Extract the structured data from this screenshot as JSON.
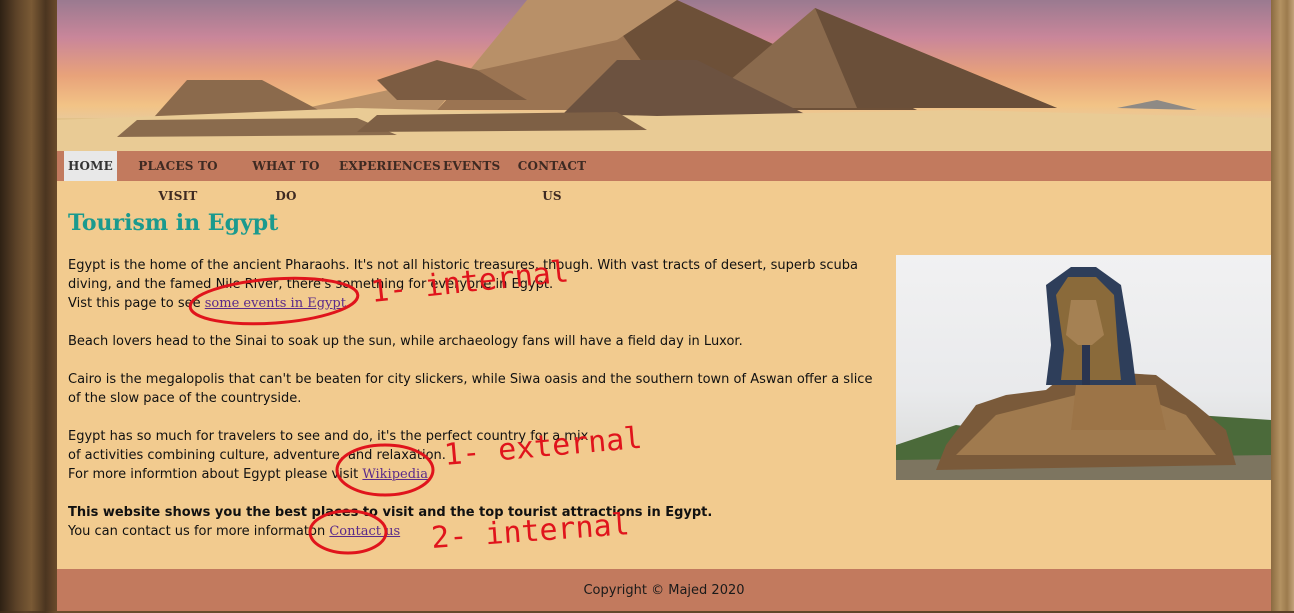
{
  "nav": {
    "items": [
      {
        "label": "HOME",
        "active": true
      },
      {
        "label": "PLACES TO VISIT",
        "active": false
      },
      {
        "label": "WHAT TO DO",
        "active": false
      },
      {
        "label": "EXPERIENCES",
        "active": false
      },
      {
        "label": "EVENTS",
        "active": false
      },
      {
        "label": "CONTACT US",
        "active": false
      }
    ]
  },
  "main": {
    "title": "Tourism in Egypt",
    "p1_text": "Egypt is the home of the ancient Pharaohs. It's not all historic treasures, though. With vast tracts of desert, superb scuba diving, and the famed Nile River, there's something for everyone in Egypt.",
    "p1_link_prefix": "Vist this page to see ",
    "p1_link": "some events in Egypt",
    "p2": "Beach lovers head to the Sinai to soak up the sun, while archaeology fans will have a field day in Luxor.",
    "p3": "Cairo is the megalopolis that can't be beaten for city slickers, while Siwa oasis and the southern town of Aswan offer a slice of the slow pace of the countryside.",
    "p4_line1": "Egypt has so much for travelers to see and do, it's the perfect country for a mix",
    "p4_line2": "of activities combining culture, adventure, and relaxation.",
    "p4_link_prefix": "For more informtion about Egypt please visit ",
    "p4_link": "Wikipedia",
    "p5_bold": "This website shows you the best places to visit and the top tourist attractions in Egypt.",
    "p5_prefix": "You can contact us for more informaton ",
    "p5_link": "Contact us"
  },
  "footer": {
    "text": "Copyright © Majed 2020"
  },
  "annotations": {
    "a1": "1- internal",
    "a2": "1- external",
    "a3": "2- internal",
    "color": "#e0141c"
  },
  "colors": {
    "page_bg": "#f2cb8f",
    "nav_bg": "#c27a5e",
    "title": "#1b9a8e",
    "link": "#5a2a8a"
  }
}
